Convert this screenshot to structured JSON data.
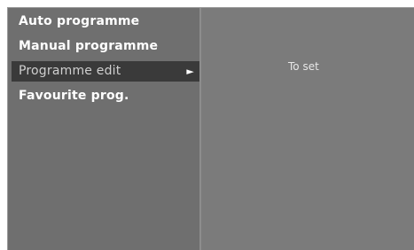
{
  "menu": {
    "items": [
      {
        "label": "Auto programme"
      },
      {
        "label": "Manual programme"
      },
      {
        "label": "Programme edit",
        "arrow": "►"
      },
      {
        "label": "Favourite prog."
      }
    ],
    "selected_index": 2
  },
  "detail": {
    "text": "To set"
  },
  "colors": {
    "panel": "#7b7b7b",
    "menu_background": "#6f6f6f",
    "selected_background": "#3a3a3a",
    "text": "#ffffff"
  },
  "icons": {
    "submenu_arrow": "right-triangle-icon"
  }
}
